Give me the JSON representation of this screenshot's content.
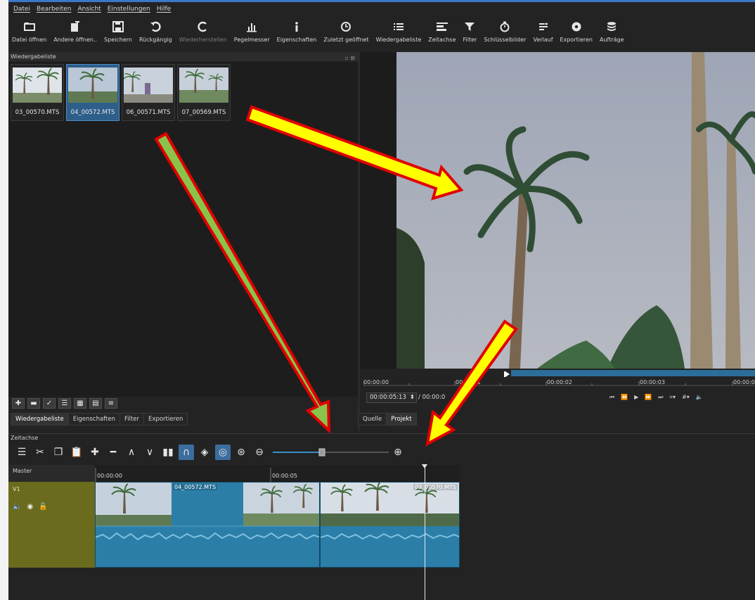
{
  "menu": [
    "Datei",
    "Bearbeiten",
    "Ansicht",
    "Einstellungen",
    "Hilfe"
  ],
  "toolbar": [
    {
      "label": "Datei öffnen",
      "icon": "folder-open-icon"
    },
    {
      "label": "Andere öffnen..",
      "icon": "open-other-icon"
    },
    {
      "label": "Speichern",
      "icon": "save-icon"
    },
    {
      "label": "Rückgängig",
      "icon": "undo-icon"
    },
    {
      "label": "Wiederherstellen",
      "icon": "redo-icon",
      "disabled": true
    },
    {
      "label": "Pegelmesser",
      "icon": "level-meter-icon"
    },
    {
      "label": "Eigenschaften",
      "icon": "info-icon"
    },
    {
      "label": "Zuletzt geöffnet",
      "icon": "clock-icon"
    },
    {
      "label": "Wiedergabeliste",
      "icon": "list-icon"
    },
    {
      "label": "Zeitachse",
      "icon": "timeline-icon"
    },
    {
      "label": "Filter",
      "icon": "filter-icon"
    },
    {
      "label": "Schlüsselbilder",
      "icon": "stopwatch-icon"
    },
    {
      "label": "Verlauf",
      "icon": "history-icon"
    },
    {
      "label": "Exportieren",
      "icon": "export-icon"
    },
    {
      "label": "Aufträge",
      "icon": "jobs-icon"
    }
  ],
  "playlist": {
    "title": "Wiedergabeliste",
    "clips": [
      "03_00570.MTS",
      "04_00572.MTS",
      "06_00571.MTS",
      "07_00569.MTS"
    ],
    "selected_index": 1,
    "tabs": [
      "Wiedergabeliste",
      "Eigenschaften",
      "Filter",
      "Exportieren"
    ]
  },
  "viewer": {
    "ruler_labels": [
      "00:00:00",
      "00:00:01",
      "00:00:02",
      "00:00:03",
      "00:00:0"
    ],
    "position": "00:00:05:13",
    "duration": "/ 00:00:0",
    "tabs": [
      "Quelle",
      "Projekt"
    ]
  },
  "timeline": {
    "title": "Zeitachse",
    "master_label": "Master",
    "track_label": "V1",
    "ruler_labels": [
      "00:00:00",
      "00:00:05"
    ],
    "clips": [
      "04_00572.MTS",
      "03_00570.MTS"
    ]
  },
  "colors": {
    "accent": "#3b6e9e",
    "clip_fill": "#2b7ea8",
    "track_header": "#6b6b1e",
    "arrow_yellow": "#ffff00",
    "arrow_green": "#8bc34a",
    "arrow_outline": "#e00000"
  }
}
